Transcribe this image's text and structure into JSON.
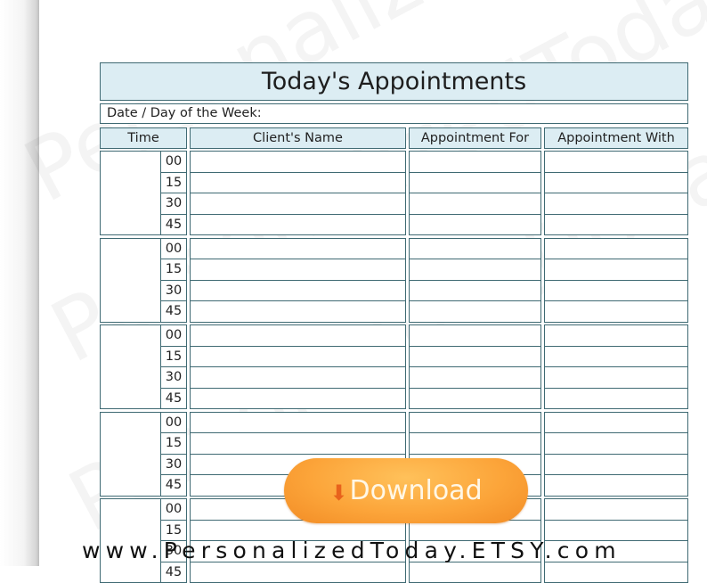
{
  "watermark": "PersonalizedToday",
  "planner": {
    "title": "Today's Appointments",
    "date_label": "Date / Day of the Week:",
    "columns": [
      "Time",
      "Client's Name",
      "Appointment For",
      "Appointment With"
    ],
    "minute_marks": [
      "00",
      "15",
      "30",
      "45"
    ],
    "hour_blocks_visible": 5
  },
  "download_button": {
    "icon": "down-arrow-icon",
    "label": "Download",
    "color": "#fca53a"
  },
  "footer_url": "www.PersonalizedToday.ETSY.com",
  "colors": {
    "border": "#3f6a73",
    "header_fill": "#dcedf3"
  }
}
